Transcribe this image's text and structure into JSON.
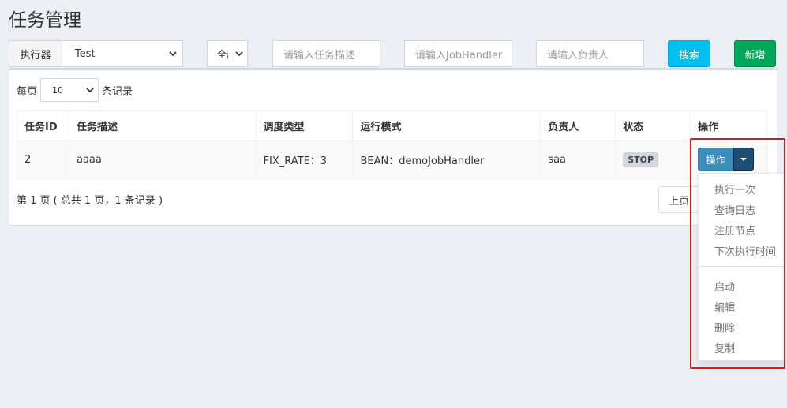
{
  "page": {
    "title": "任务管理"
  },
  "filters": {
    "executor_label": "执行器",
    "executor_value": "Test",
    "status_value": "全部",
    "desc_placeholder": "请输入任务描述",
    "handler_placeholder": "请输入JobHandler",
    "author_placeholder": "请输入负责人",
    "search_label": "搜索",
    "add_label": "新增"
  },
  "length": {
    "prefix": "每页",
    "value": "10",
    "suffix": "条记录"
  },
  "table": {
    "headers": [
      "任务ID",
      "任务描述",
      "调度类型",
      "运行模式",
      "负责人",
      "状态",
      "操作"
    ],
    "rows": [
      {
        "id": "2",
        "desc": "aaaa",
        "schedule": "FIX_RATE：3",
        "mode": "BEAN：demoJobHandler",
        "author": "saa",
        "status": "STOP"
      }
    ]
  },
  "info": "第 1 页 ( 总共 1 页，1 条记录 )",
  "pager": {
    "prev_label": "上页"
  },
  "actions": {
    "button_label": "操作",
    "menu_group1": [
      "执行一次",
      "查询日志",
      "注册节点",
      "下次执行时间"
    ],
    "menu_group2": [
      "启动",
      "编辑",
      "删除",
      "复制"
    ]
  },
  "colors": {
    "search": "#00c0ef",
    "add": "#00a65a",
    "action": "#3c8dbc",
    "highlight": "#e0161c"
  }
}
